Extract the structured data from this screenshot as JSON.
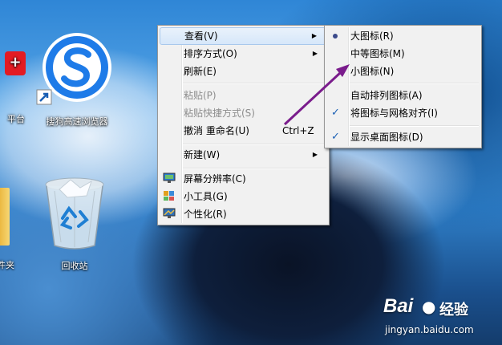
{
  "desktop_icons": [
    {
      "label": "平台"
    },
    {
      "label": "搜狗高速浏览器"
    },
    {
      "label": "件夹"
    },
    {
      "label": "回收站"
    }
  ],
  "context_menu": {
    "items": [
      {
        "label": "查看(V)",
        "accel": "",
        "disabled": false,
        "submenu": true
      },
      {
        "label": "排序方式(O)",
        "accel": "",
        "disabled": false,
        "submenu": true
      },
      {
        "label": "刷新(E)",
        "accel": "",
        "disabled": false,
        "submenu": false
      },
      {
        "label": "粘贴(P)",
        "accel": "",
        "disabled": true,
        "submenu": false
      },
      {
        "label": "粘贴快捷方式(S)",
        "accel": "",
        "disabled": true,
        "submenu": false
      },
      {
        "label": "撤消 重命名(U)",
        "accel": "Ctrl+Z",
        "disabled": false,
        "submenu": false
      },
      {
        "label": "新建(W)",
        "accel": "",
        "disabled": false,
        "submenu": true
      },
      {
        "label": "屏幕分辨率(C)",
        "accel": "",
        "disabled": false,
        "submenu": false
      },
      {
        "label": "小工具(G)",
        "accel": "",
        "disabled": false,
        "submenu": false
      },
      {
        "label": "个性化(R)",
        "accel": "",
        "disabled": false,
        "submenu": false
      }
    ]
  },
  "view_submenu": {
    "items": [
      {
        "label": "大图标(R)",
        "mark": "radio"
      },
      {
        "label": "中等图标(M)",
        "mark": ""
      },
      {
        "label": "小图标(N)",
        "mark": ""
      },
      {
        "label": "自动排列图标(A)",
        "mark": ""
      },
      {
        "label": "将图标与网格对齐(I)",
        "mark": "check"
      },
      {
        "label": "显示桌面图标(D)",
        "mark": "check"
      }
    ]
  },
  "watermark": {
    "brand": "Bai",
    "brand_suffix": "经验",
    "url": "jingyan.baidu.com"
  },
  "colors": {
    "highlight_border": "#a8c8ec",
    "arrow": "#7a1c8c",
    "check": "#1a5fb4"
  }
}
